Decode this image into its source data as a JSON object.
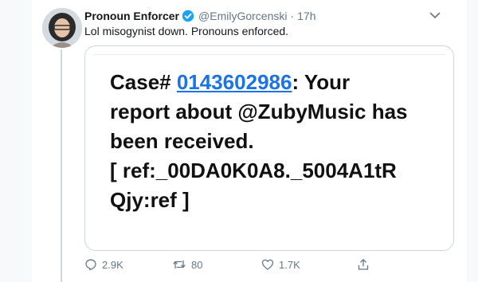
{
  "tweet": {
    "display_name": "Pronoun Enforcer",
    "handle": "@EmilyGorcenski",
    "separator": "·",
    "time": "17h",
    "text": "Lol misogynist down. Pronouns enforced."
  },
  "card": {
    "prefix": "Case# ",
    "case_number": "0143602986",
    "rest_line1": ": Your",
    "line2": "report about @ZubyMusic has",
    "line3": "been received.",
    "line4": "[ ref:_00DA0K0A8._5004A1tR",
    "line5": "Qjy:ref ]"
  },
  "actions": {
    "reply_count": "2.9K",
    "retweet_count": "80",
    "like_count": "1.7K"
  },
  "colors": {
    "link": "#1a73e8",
    "verified": "#1da1f2",
    "muted": "#657786"
  },
  "icons": [
    "verified-badge-icon",
    "chevron-down-icon",
    "reply-icon",
    "retweet-icon",
    "like-icon",
    "share-icon"
  ]
}
